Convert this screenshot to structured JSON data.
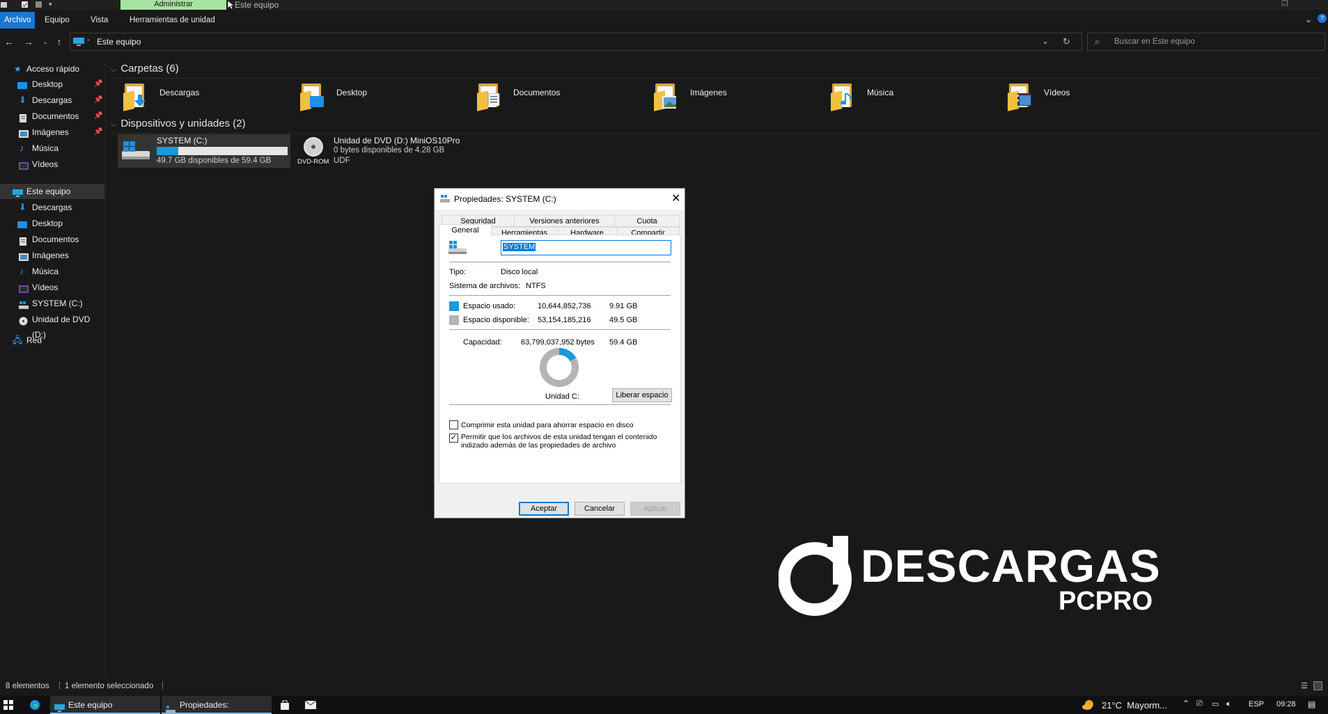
{
  "titlebar": {
    "admin_tab": "Administrar",
    "title": "Este equipo"
  },
  "ribbon": {
    "tabs": [
      "Archivo",
      "Equipo",
      "Vista",
      "Herramientas de unidad"
    ],
    "active_color": "#1976d2"
  },
  "address": {
    "path": "Este equipo",
    "search_placeholder": "Buscar en Este equipo"
  },
  "sidebar": {
    "quick_access": "Acceso rápido",
    "quick_items": [
      "Desktop",
      "Descargas",
      "Documentos",
      "Imágenes",
      "Música",
      "Vídeos"
    ],
    "this_pc": "Este equipo",
    "pc_items": [
      "Descargas",
      "Desktop",
      "Documentos",
      "Imágenes",
      "Música",
      "Vídeos",
      "SYSTEM (C:)",
      "Unidad de DVD (D:)"
    ],
    "network": "Red"
  },
  "folders_group": {
    "title": "Carpetas (6)",
    "items": [
      "Descargas",
      "Desktop",
      "Documentos",
      "Imágenes",
      "Música",
      "Vídeos"
    ]
  },
  "devices_group": {
    "title": "Dispositivos y unidades (2)",
    "drive_c": {
      "name": "SYSTEM (C:)",
      "space": "49.7 GB disponibles de 59.4 GB",
      "used_fraction": 0.163
    },
    "drive_d": {
      "name": "Unidad de DVD (D:) MiniOS10Pro",
      "space": "0 bytes disponibles de 4.28 GB",
      "fs": "UDF",
      "badge": "DVD-ROM"
    }
  },
  "dialog": {
    "title": "Propiedades: SYSTEM (C:)",
    "tabs_row1": [
      "Seguridad",
      "Versiones anteriores",
      "Cuota"
    ],
    "tabs_row2": [
      "General",
      "Herramientas",
      "Hardware",
      "Compartir"
    ],
    "name_value": "SYSTEM",
    "type_label": "Tipo:",
    "type_value": "Disco local",
    "fs_label": "Sistema de archivos:",
    "fs_value": "NTFS",
    "used_label": "Espacio usado:",
    "used_bytes": "10,644,852,736",
    "used_gb": "9.91 GB",
    "free_label": "Espacio disponible:",
    "free_bytes": "53,154,185,216",
    "free_gb": "49.5 GB",
    "capacity_label": "Capacidad:",
    "capacity_bytes": "63,799,037,952 bytes",
    "capacity_gb": "59.4 GB",
    "drive_label": "Unidad C:",
    "cleanup_button": "Liberar espacio",
    "compress_label": "Comprimir esta unidad para ahorrar espacio en disco",
    "index_label_1": "Permitir que los archivos de esta unidad tengan el contenido",
    "index_label_2": "indizado además de las propiedades de archivo",
    "compress_checked": false,
    "index_checked": true,
    "ok": "Aceptar",
    "cancel": "Cancelar",
    "apply": "Aplicar",
    "used_color": "#1a9ad8",
    "free_color": "#b4b4b4",
    "used_fraction": 0.167
  },
  "watermark": {
    "line1": "DESCARGAS",
    "line2": "PCPRO"
  },
  "status": {
    "count": "8 elementos",
    "selection": "1 elemento seleccionado"
  },
  "taskbar": {
    "app1": "Este equipo",
    "app2": "Propiedades: SYSTEM...",
    "weather": "21°C  Mayorm...",
    "lang": "ESP",
    "time": "09:28"
  }
}
